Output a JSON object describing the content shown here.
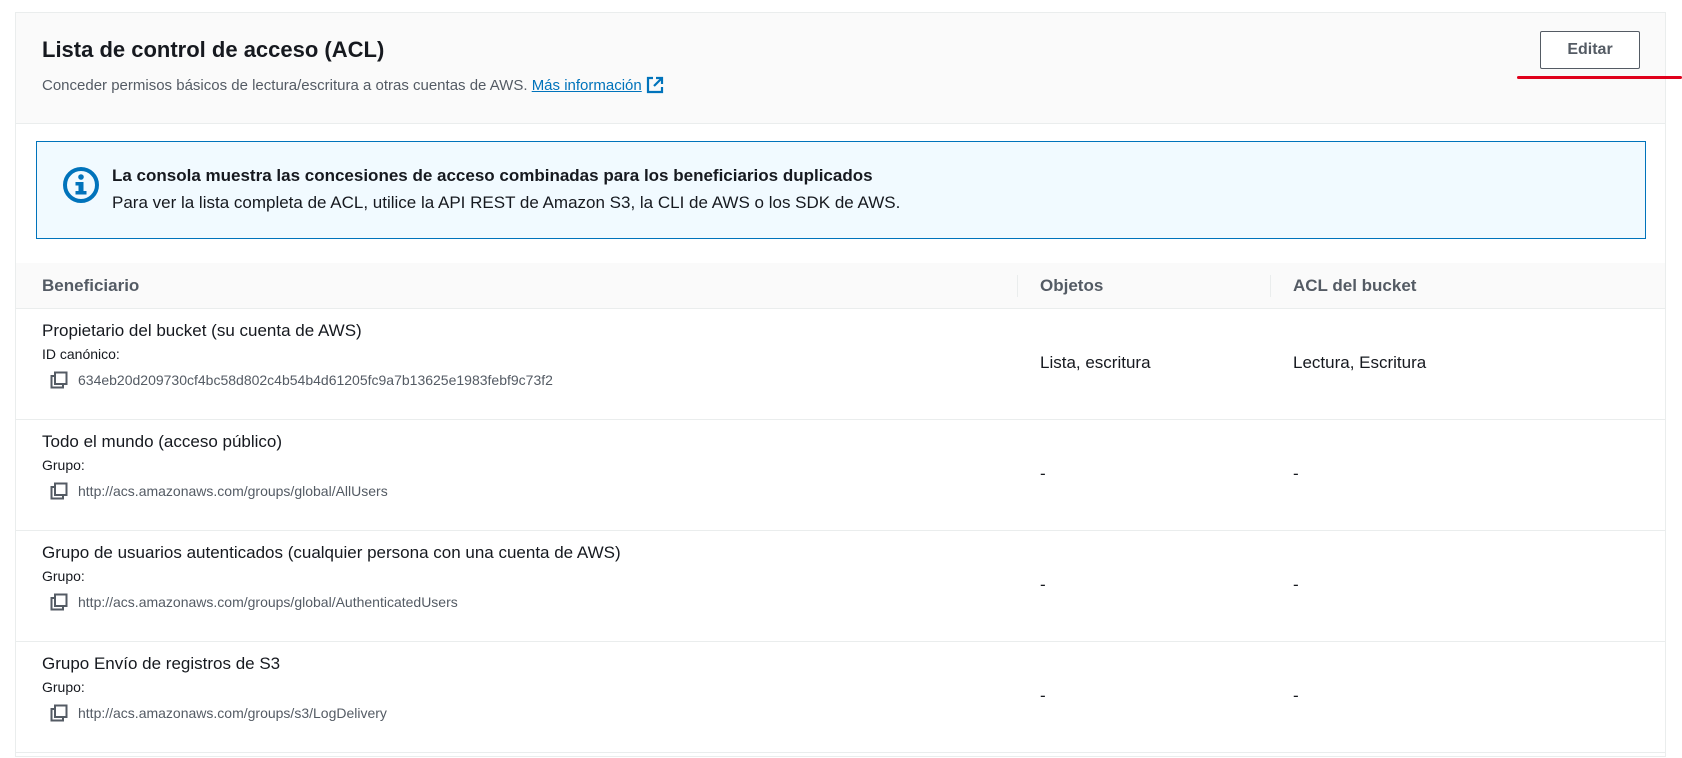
{
  "header": {
    "title": "Lista de control de acceso (ACL)",
    "description": "Conceder permisos básicos de lectura/escritura a otras cuentas de AWS.",
    "more_info_link": "Más información",
    "edit_button": "Editar"
  },
  "info_alert": {
    "title": "La consola muestra las concesiones de acceso combinadas para los beneficiarios duplicados",
    "text": "Para ver la lista completa de ACL, utilice la API REST de Amazon S3, la CLI de AWS o los SDK de AWS."
  },
  "table": {
    "columns": [
      "Beneficiario",
      "Objetos",
      "ACL del bucket"
    ],
    "rows": [
      {
        "grantee": "Propietario del bucket (su cuenta de AWS)",
        "id_label": "ID canónico:",
        "id_value": "634eb20d209730cf4bc58d802c4b54b4d61205fc9a7b13625e1983febf9c73f2",
        "objects": "Lista, escritura",
        "bucket_acl": "Lectura, Escritura"
      },
      {
        "grantee": "Todo el mundo (acceso público)",
        "id_label": "Grupo:",
        "id_value": "http://acs.amazonaws.com/groups/global/AllUsers",
        "objects": "-",
        "bucket_acl": "-"
      },
      {
        "grantee": "Grupo de usuarios autenticados (cualquier persona con una cuenta de AWS)",
        "id_label": "Grupo:",
        "id_value": "http://acs.amazonaws.com/groups/global/AuthenticatedUsers",
        "objects": "-",
        "bucket_acl": "-"
      },
      {
        "grantee": "Grupo Envío de registros de S3",
        "id_label": "Grupo:",
        "id_value": "http://acs.amazonaws.com/groups/s3/LogDelivery",
        "objects": "-",
        "bucket_acl": "-"
      }
    ]
  },
  "icons": {
    "info": "info-circle-icon",
    "external_link": "external-link-icon",
    "copy": "copy-icon"
  },
  "colors": {
    "link": "#0073bb",
    "info_border": "#0073bb",
    "info_bg": "#f1faff",
    "annotation_red": "#e0001b"
  }
}
